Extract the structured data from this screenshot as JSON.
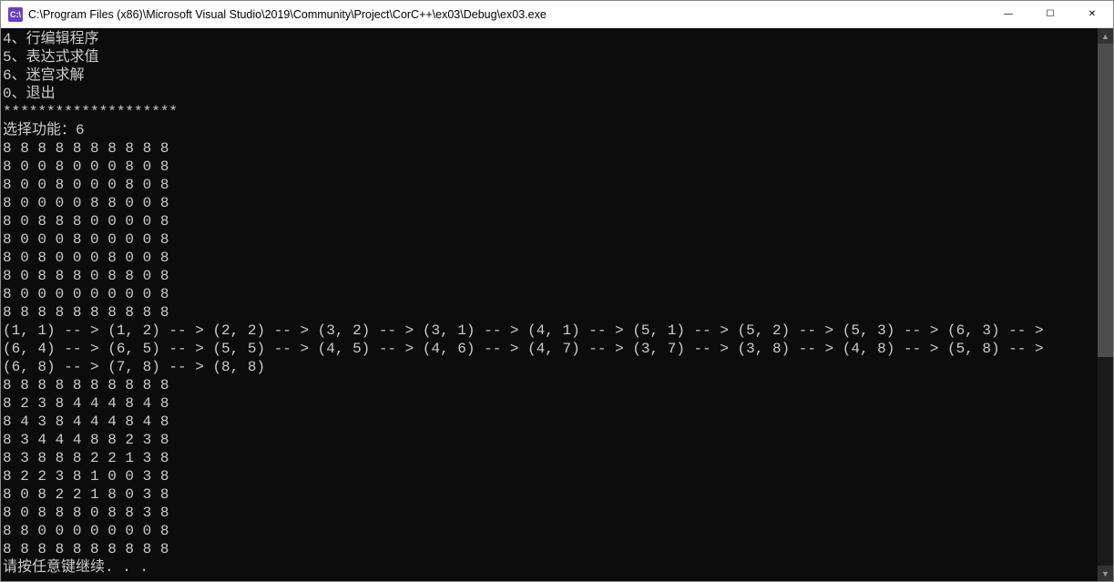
{
  "titlebar": {
    "icon_label": "C:\\",
    "path": "C:\\Program Files (x86)\\Microsoft Visual Studio\\2019\\Community\\Project\\CorC++\\ex03\\Debug\\ex03.exe"
  },
  "window_controls": {
    "minimize": "—",
    "maximize": "☐",
    "close": "✕"
  },
  "console": {
    "menu_lines": [
      "4、行编辑程序",
      "5、表达式求值",
      "6、迷宫求解",
      "0、退出",
      "********************",
      "选择功能：6"
    ],
    "maze_initial": [
      "8 8 8 8 8 8 8 8 8 8",
      "8 0 0 8 0 0 0 8 0 8",
      "8 0 0 8 0 0 0 8 0 8",
      "8 0 0 0 0 8 8 0 0 8",
      "8 0 8 8 8 0 0 0 0 8",
      "8 0 0 0 8 0 0 0 0 8",
      "8 0 8 0 0 0 8 0 0 8",
      "8 0 8 8 8 0 8 8 0 8",
      "8 0 0 0 0 0 0 0 0 8",
      "8 8 8 8 8 8 8 8 8 8"
    ],
    "path_coords": [
      [
        1,
        1
      ],
      [
        1,
        2
      ],
      [
        2,
        2
      ],
      [
        3,
        2
      ],
      [
        3,
        1
      ],
      [
        4,
        1
      ],
      [
        5,
        1
      ],
      [
        5,
        2
      ],
      [
        5,
        3
      ],
      [
        6,
        3
      ],
      [
        6,
        4
      ],
      [
        6,
        5
      ],
      [
        5,
        5
      ],
      [
        4,
        5
      ],
      [
        4,
        6
      ],
      [
        4,
        7
      ],
      [
        3,
        7
      ],
      [
        3,
        8
      ],
      [
        4,
        8
      ],
      [
        5,
        8
      ],
      [
        6,
        8
      ],
      [
        7,
        8
      ],
      [
        8,
        8
      ]
    ],
    "maze_after": [
      "8 8 8 8 8 8 8 8 8 8",
      "8 2 3 8 4 4 4 8 4 8",
      "8 4 3 8 4 4 4 8 4 8",
      "8 3 4 4 4 8 8 2 3 8",
      "8 3 8 8 8 2 2 1 3 8",
      "8 2 2 3 8 1 0 0 3 8",
      "8 0 8 2 2 1 8 0 3 8",
      "8 0 8 8 8 0 8 8 3 8",
      "8 8 0 0 0 0 0 0 0 8",
      "8 8 8 8 8 8 8 8 8 8"
    ],
    "prompt": "请按任意键继续. . ."
  }
}
